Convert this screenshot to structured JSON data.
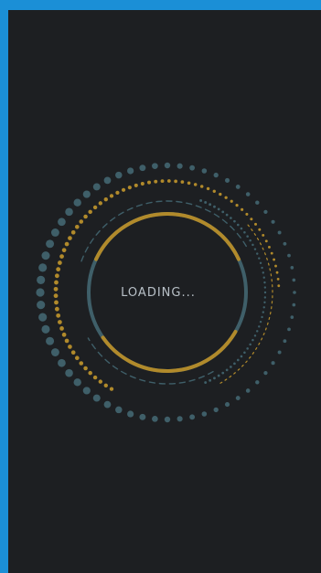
{
  "loading_text": "LOADING...",
  "colors": {
    "background": "#1d1f22",
    "border": "#1b8fd6",
    "teal": "#3f5f69",
    "gold": "#b18a2b",
    "text": "#b8c0c7"
  },
  "icons": [
    "spinner-icon"
  ]
}
